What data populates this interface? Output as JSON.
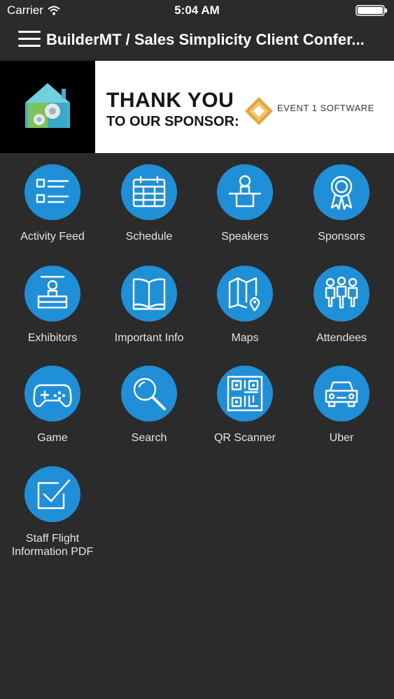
{
  "status": {
    "carrier": "Carrier",
    "time": "5:04 AM"
  },
  "nav": {
    "title": "BuilderMT / Sales Simplicity Client Confer..."
  },
  "banner": {
    "line1": "THANK YOU",
    "line2": "TO OUR SPONSOR:",
    "sponsor_name": "EVENT 1 SOFTWARE"
  },
  "tiles": [
    {
      "label": "Activity Feed",
      "icon": "list-icon"
    },
    {
      "label": "Schedule",
      "icon": "calendar-icon"
    },
    {
      "label": "Speakers",
      "icon": "speaker-icon"
    },
    {
      "label": "Sponsors",
      "icon": "ribbon-icon"
    },
    {
      "label": "Exhibitors",
      "icon": "booth-icon"
    },
    {
      "label": "Important Info",
      "icon": "book-icon"
    },
    {
      "label": "Maps",
      "icon": "map-icon"
    },
    {
      "label": "Attendees",
      "icon": "people-icon"
    },
    {
      "label": "Game",
      "icon": "gamepad-icon"
    },
    {
      "label": "Search",
      "icon": "search-icon"
    },
    {
      "label": "QR Scanner",
      "icon": "qr-code-icon"
    },
    {
      "label": "Uber",
      "icon": "car-icon"
    },
    {
      "label": "Staff Flight\nInformation PDF",
      "icon": "checkbox-icon"
    }
  ],
  "colors": {
    "background": "#2b2b2b",
    "icon_circle": "#1f8fd8",
    "label": "#e4e4e4"
  }
}
